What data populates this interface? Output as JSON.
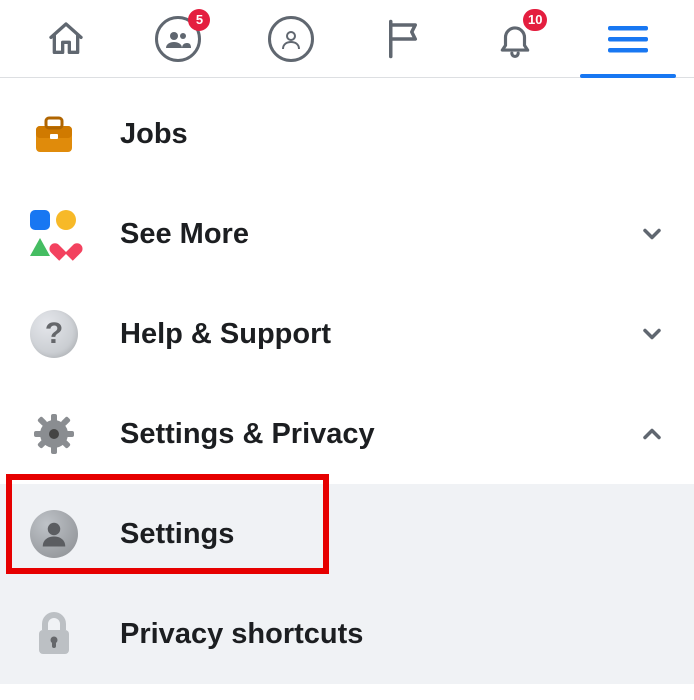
{
  "topbar": {
    "groups_badge": "5",
    "notifications_badge": "10"
  },
  "menu": {
    "jobs": "Jobs",
    "see_more": "See More",
    "help": "Help & Support",
    "settings_privacy": "Settings & Privacy",
    "settings": "Settings",
    "privacy_shortcuts": "Privacy shortcuts"
  }
}
